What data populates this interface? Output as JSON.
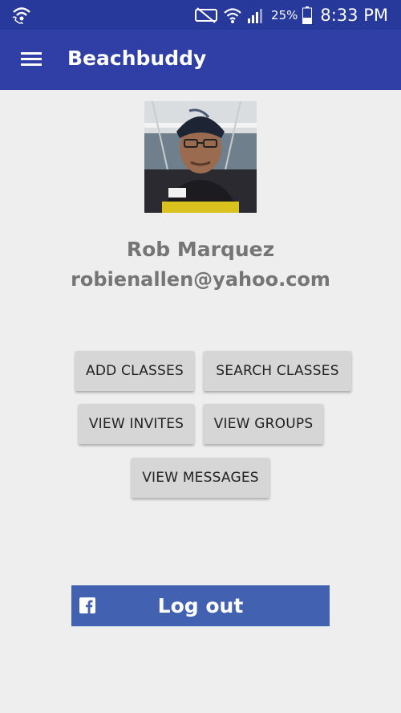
{
  "status_bar": {
    "battery_percent": "25%",
    "time": "8:33 PM",
    "icons": [
      "wifi-call-icon",
      "mute-icon",
      "wifi-icon",
      "signal-icon",
      "battery-icon"
    ]
  },
  "app_bar": {
    "title": "Beachbuddy",
    "menu_icon": "hamburger-menu-icon"
  },
  "profile": {
    "name": "Rob Marquez",
    "email": "robienallen@yahoo.com"
  },
  "actions": {
    "add_classes": "ADD CLASSES",
    "search_classes": "SEARCH CLASSES",
    "view_invites": "VIEW INVITES",
    "view_groups": "VIEW GROUPS",
    "view_messages": "VIEW MESSAGES"
  },
  "facebook": {
    "logout_label": "Log out",
    "icon": "facebook-icon"
  },
  "colors": {
    "app_bar": "#2f3fa6",
    "status_bar": "#27399a",
    "background": "#eeeeee",
    "button": "#d6d6d6",
    "facebook_blue": "#4262b1",
    "profile_text": "#757575"
  }
}
